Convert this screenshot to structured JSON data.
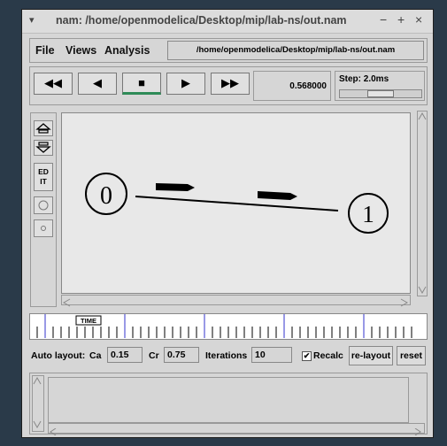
{
  "window": {
    "title": "nam: /home/openmodelica/Desktop/mip/lab-ns/out.nam",
    "menu_glyph": "▾",
    "minimize": "−",
    "maximize": "+",
    "close": "×"
  },
  "menubar": {
    "file": "File",
    "views": "Views",
    "analysis": "Analysis",
    "path": "/home/openmodelica/Desktop/mip/lab-ns/out.nam"
  },
  "controls": {
    "rewind": "◀◀",
    "back": "◀",
    "stop": "■",
    "play": "▶",
    "fast_forward": "▶▶",
    "time": "0.568000",
    "step_label": "Step: 2.0ms",
    "step_slider_position": 0.5
  },
  "tools": {
    "edit": "ED\nIT"
  },
  "graph": {
    "nodes": [
      {
        "id": "node-0",
        "label": "0"
      },
      {
        "id": "node-1",
        "label": "1"
      }
    ]
  },
  "timeline": {
    "marker_label": "TIME"
  },
  "autolayout": {
    "label": "Auto layout:",
    "ca_label": "Ca",
    "ca_value": "0.15",
    "cr_label": "Cr",
    "cr_value": "0.75",
    "iterations_label": "Iterations",
    "iterations_value": "10",
    "recalc_label": "Recalc",
    "recalc_checked": "✔",
    "relayout_label": "re-layout",
    "reset_label": "reset"
  }
}
